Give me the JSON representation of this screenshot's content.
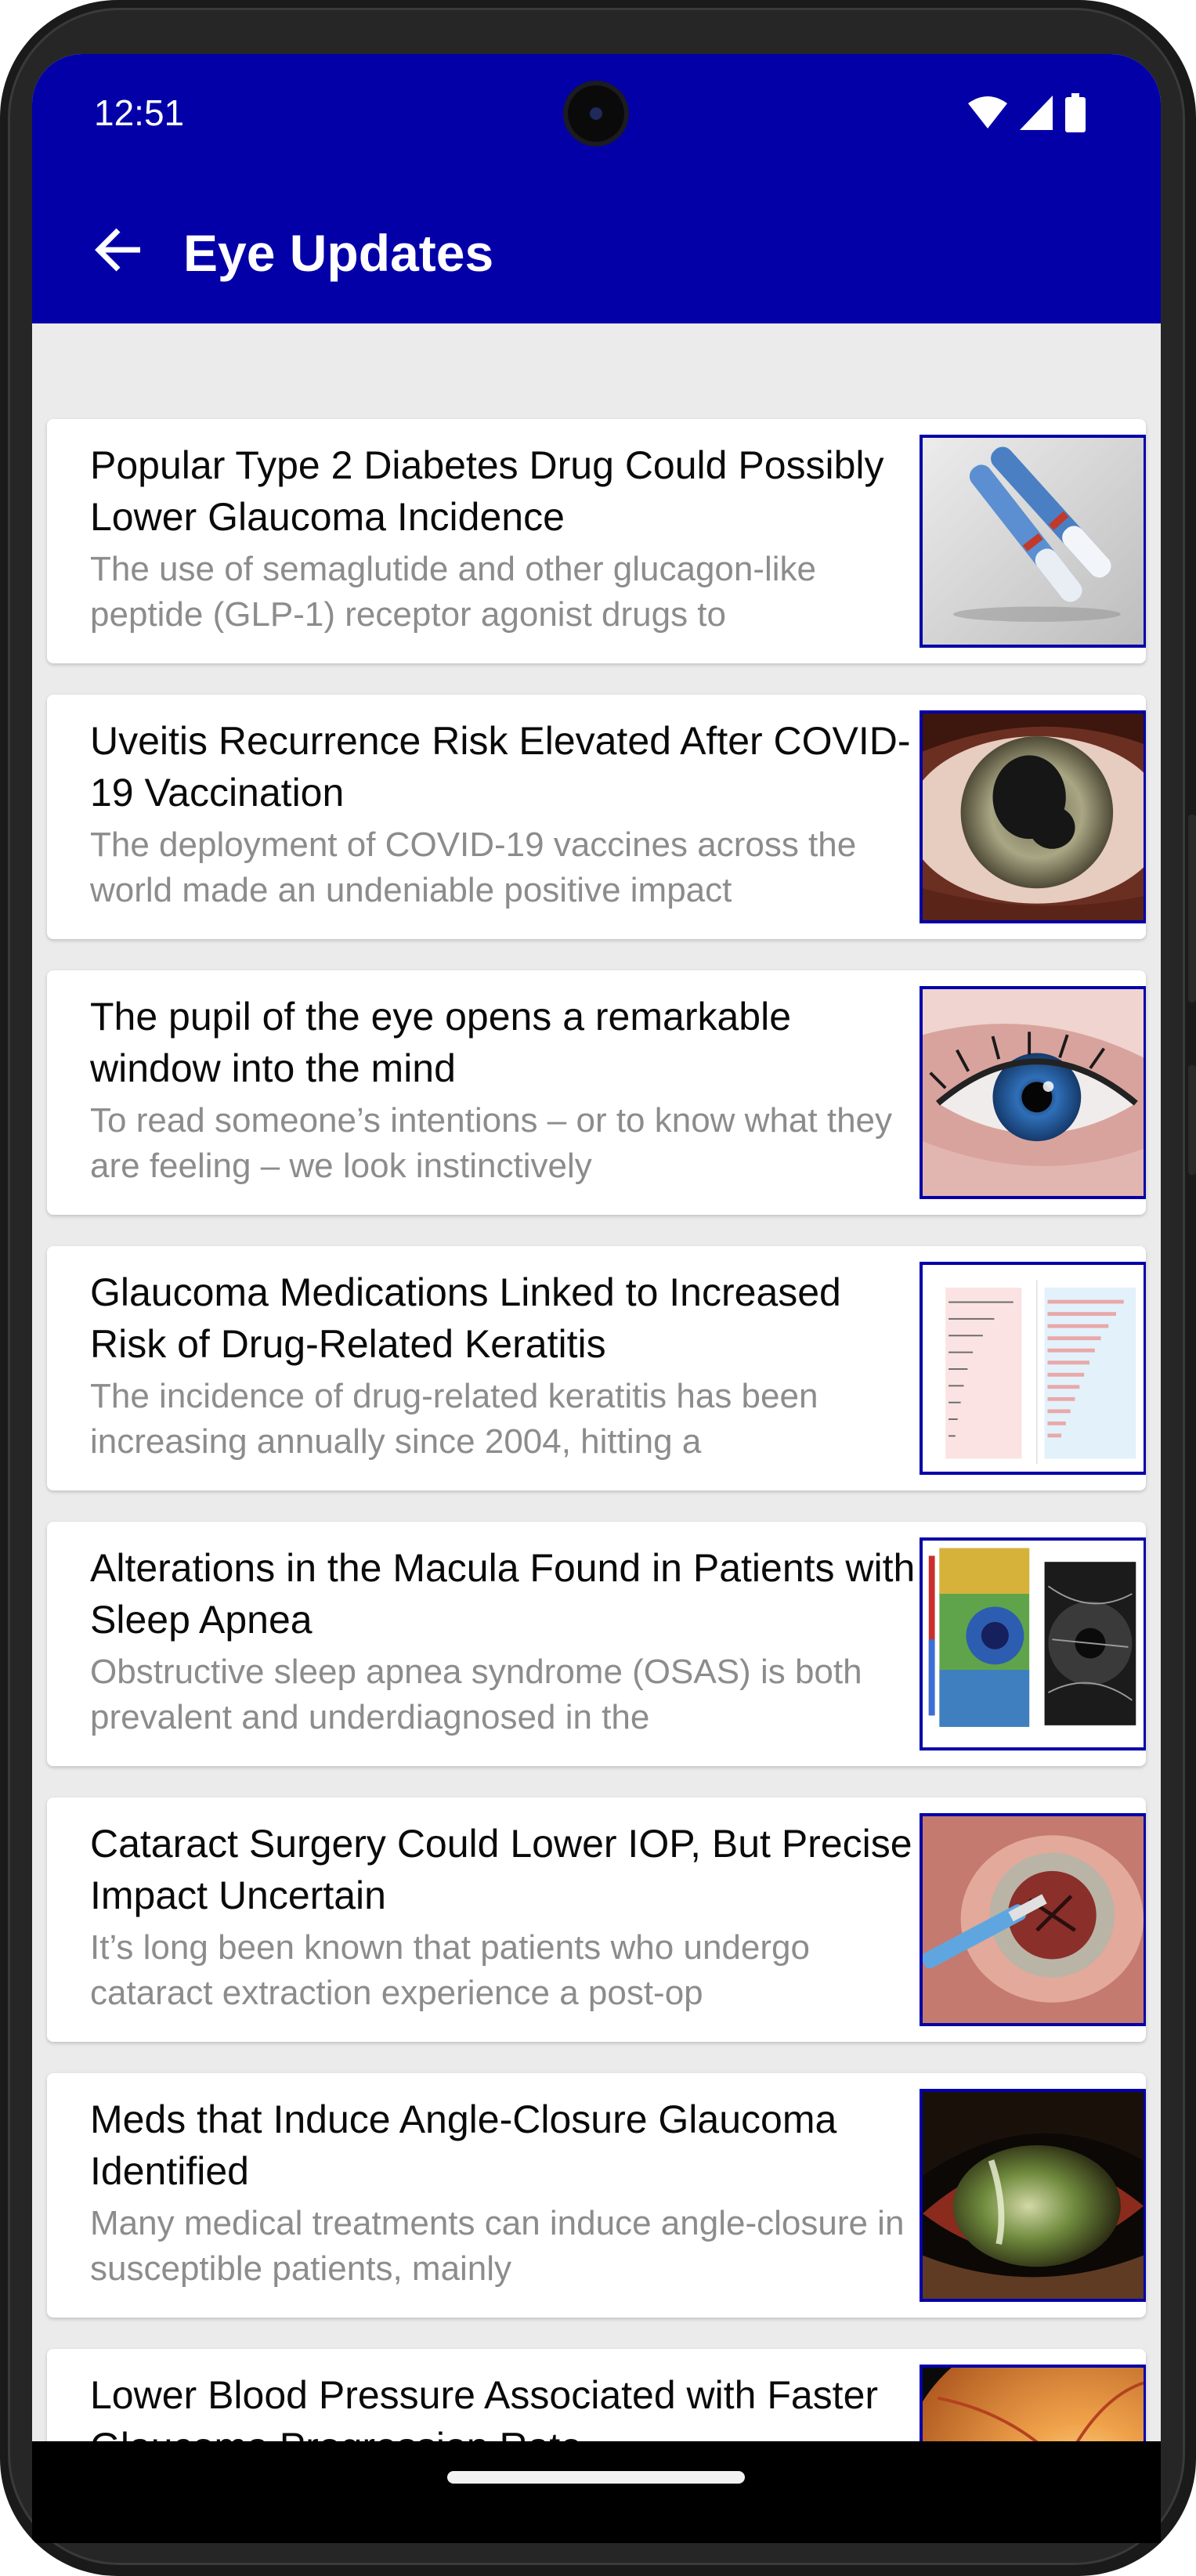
{
  "status_bar": {
    "time": "12:51",
    "icons": [
      "wifi-icon",
      "signal-icon",
      "battery-icon"
    ]
  },
  "toolbar": {
    "back_icon": "arrow-left-icon",
    "title": "Eye Updates"
  },
  "colors": {
    "header_background": "#0400a8",
    "thumbnail_border": "#0400a8",
    "title_text": "#0a0a0a",
    "snippet_text": "#8c8c8c",
    "page_background": "#ebebeb"
  },
  "articles": [
    {
      "title": "Popular Type 2 Diabetes Drug Could Possibly Lower Glaucoma Incidence",
      "snippet": "The use of semaglutide and other glucagon-like peptide (GLP-1) receptor agonist drugs to",
      "thumbnail": "injection-pens-image"
    },
    {
      "title": "Uveitis Recurrence Risk Elevated After COVID-19 Vaccination",
      "snippet": "The deployment of COVID-19 vaccines across the world made an undeniable positive impact",
      "thumbnail": "eye-closeup-image"
    },
    {
      "title": "The pupil of the eye opens a remarkable window into the mind",
      "snippet": "To read someone’s intentions – or to know what they are feeling – we look instinctively",
      "thumbnail": "blue-eye-image"
    },
    {
      "title": "Glaucoma Medications Linked to Increased Risk of Drug-Related Keratitis",
      "snippet": "The incidence of drug-related keratitis has been increasing annually since 2004, hitting a",
      "thumbnail": "keratitis-chart-image"
    },
    {
      "title": "Alterations in the Macula Found in Patients with Sleep Apnea",
      "snippet": "Obstructive sleep apnea syndrome (OSAS) is both prevalent and underdiagnosed in the",
      "thumbnail": "macula-scan-image"
    },
    {
      "title": "Cataract Surgery Could Lower IOP, But Precise Impact Uncertain",
      "snippet": "It’s long been known that patients who undergo cataract extraction experience a post-op",
      "thumbnail": "cataract-surgery-image"
    },
    {
      "title": "Meds that Induce Angle-Closure Glaucoma Identified",
      "snippet": "Many medical treatments can induce angle-closure in susceptible patients, mainly",
      "thumbnail": "angle-closure-eye-image"
    },
    {
      "title": "Lower Blood Pressure Associated with Faster Glaucoma Progression Rate",
      "snippet": "",
      "thumbnail": "fundus-image"
    }
  ]
}
